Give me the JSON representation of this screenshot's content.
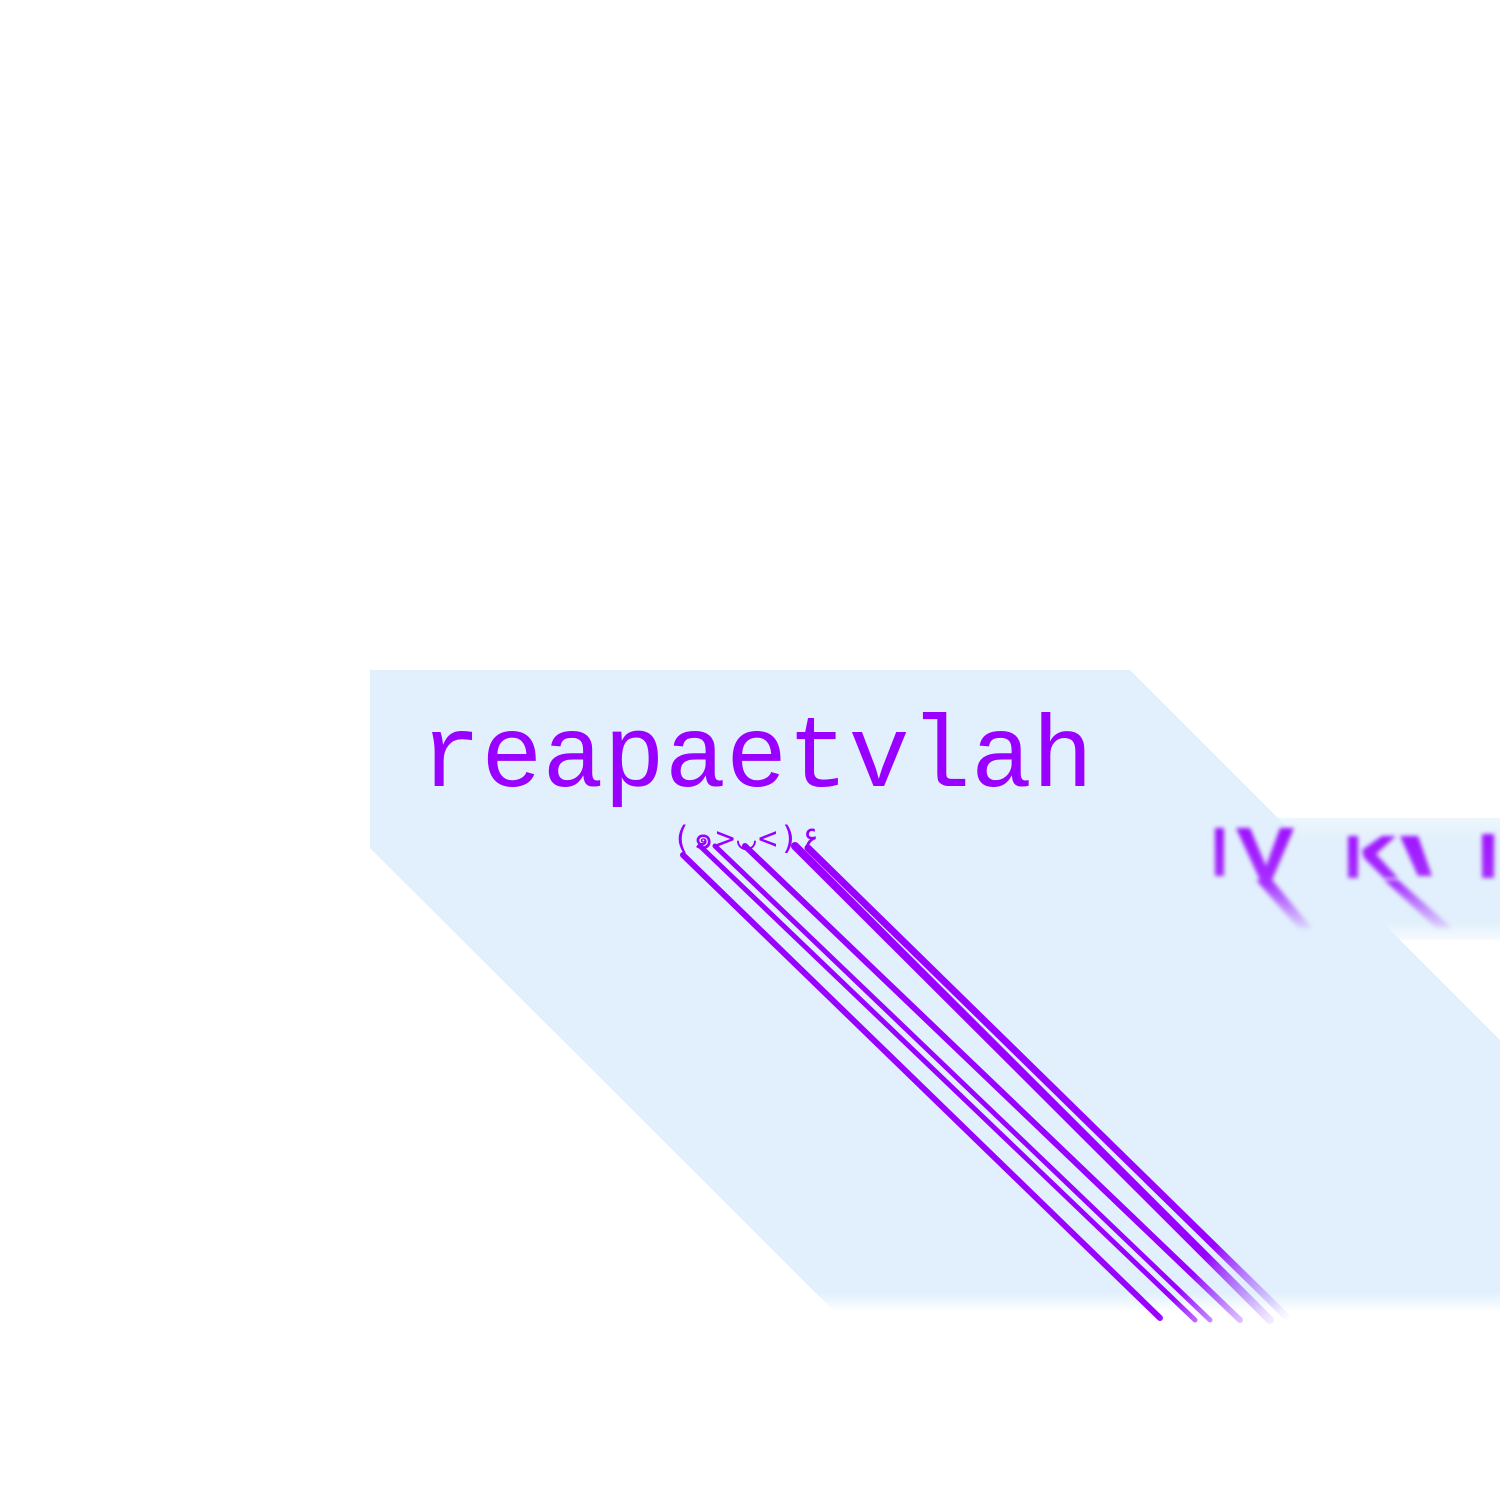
{
  "title": "reapaetvlah",
  "kaomoji": "(๑>◡<)۶",
  "colors": {
    "background": "#ffffff",
    "panel": "#e1f0fc",
    "text": "#9900ff"
  }
}
